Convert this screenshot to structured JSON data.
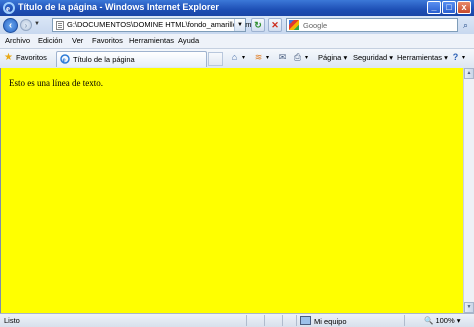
{
  "window": {
    "title": "Título de la página - Windows Internet Explorer",
    "buttons": {
      "minimize": "_",
      "maximize": "□",
      "close": "x"
    }
  },
  "address_bar": {
    "url": "G:\\DOCUMENTOS\\DOMINE HTML\\fondo_amarillo.htm",
    "search_placeholder": "Google"
  },
  "menu": [
    "Archivo",
    "Edición",
    "Ver",
    "Favoritos",
    "Herramientas",
    "Ayuda"
  ],
  "favorites_label": "Favoritos",
  "tab": {
    "label": "Título de la página"
  },
  "command_bar": {
    "page": "Página",
    "security": "Seguridad",
    "tools": "Herramientas"
  },
  "content": {
    "background_color": "#ffff00",
    "text": "Esto es una línea de texto."
  },
  "status": {
    "text": "Listo",
    "zone": "Mi equipo",
    "zoom": "100%"
  }
}
